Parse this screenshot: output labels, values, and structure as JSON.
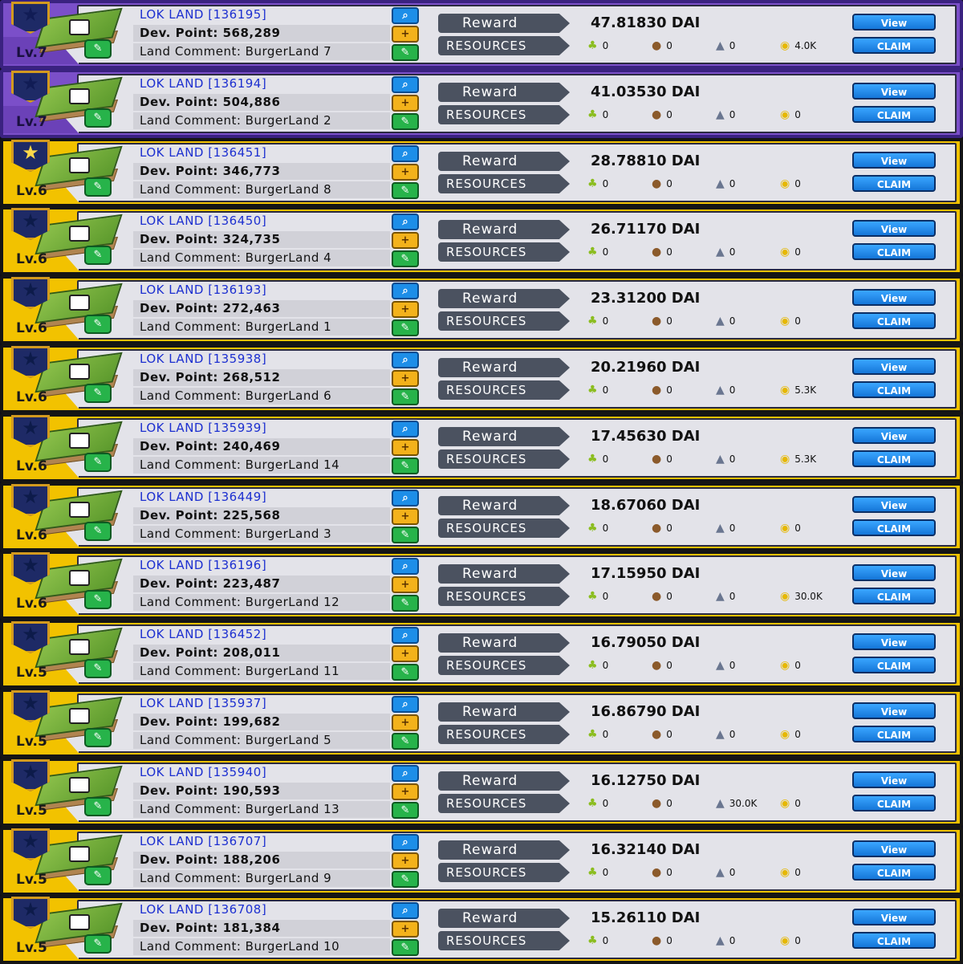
{
  "resource_icons": [
    "corn-icon",
    "meat-icon",
    "stone-icon",
    "gold-icon"
  ],
  "colors": {
    "lv7_frame": "#7b4fc9",
    "gold_frame": "#f2c200",
    "button": "#1576d8",
    "pill": "#4b5260"
  },
  "labels": {
    "reward": "Reward",
    "resources": "RESOURCES",
    "view": "View",
    "claim": "CLAIM"
  },
  "lands": [
    {
      "level": "Lv.7",
      "name": "LOK LAND [136195]",
      "dev": "Dev. Point: 568,289",
      "comment": "Land Comment: BurgerLand 7",
      "reward": "47.81830 DAI",
      "res": [
        "0",
        "0",
        "0",
        "4.0K"
      ],
      "star": "dark",
      "frame": "lv7"
    },
    {
      "level": "Lv.7",
      "name": "LOK LAND [136194]",
      "dev": "Dev. Point: 504,886",
      "comment": "Land Comment: BurgerLand 2",
      "reward": "41.03530 DAI",
      "res": [
        "0",
        "0",
        "0",
        "0"
      ],
      "star": "dark",
      "frame": "lv7"
    },
    {
      "level": "Lv.6",
      "name": "LOK LAND [136451]",
      "dev": "Dev. Point: 346,773",
      "comment": "Land Comment: BurgerLand 8",
      "reward": "28.78810 DAI",
      "res": [
        "0",
        "0",
        "0",
        "0"
      ],
      "star": "yellow",
      "frame": "gold"
    },
    {
      "level": "Lv.6",
      "name": "LOK LAND [136450]",
      "dev": "Dev. Point: 324,735",
      "comment": "Land Comment: BurgerLand 4",
      "reward": "26.71170 DAI",
      "res": [
        "0",
        "0",
        "0",
        "0"
      ],
      "star": "dark",
      "frame": "gold"
    },
    {
      "level": "Lv.6",
      "name": "LOK LAND [136193]",
      "dev": "Dev. Point: 272,463",
      "comment": "Land Comment: BurgerLand 1",
      "reward": "23.31200 DAI",
      "res": [
        "0",
        "0",
        "0",
        "0"
      ],
      "star": "dark",
      "frame": "gold"
    },
    {
      "level": "Lv.6",
      "name": "LOK LAND [135938]",
      "dev": "Dev. Point: 268,512",
      "comment": "Land Comment: BurgerLand 6",
      "reward": "20.21960 DAI",
      "res": [
        "0",
        "0",
        "0",
        "5.3K"
      ],
      "star": "dark",
      "frame": "gold"
    },
    {
      "level": "Lv.6",
      "name": "LOK LAND [135939]",
      "dev": "Dev. Point: 240,469",
      "comment": "Land Comment: BurgerLand 14",
      "reward": "17.45630 DAI",
      "res": [
        "0",
        "0",
        "0",
        "5.3K"
      ],
      "star": "dark",
      "frame": "gold"
    },
    {
      "level": "Lv.6",
      "name": "LOK LAND [136449]",
      "dev": "Dev. Point: 225,568",
      "comment": "Land Comment: BurgerLand 3",
      "reward": "18.67060 DAI",
      "res": [
        "0",
        "0",
        "0",
        "0"
      ],
      "star": "dark",
      "frame": "gold"
    },
    {
      "level": "Lv.6",
      "name": "LOK LAND [136196]",
      "dev": "Dev. Point: 223,487",
      "comment": "Land Comment: BurgerLand 12",
      "reward": "17.15950 DAI",
      "res": [
        "0",
        "0",
        "0",
        "30.0K"
      ],
      "star": "dark",
      "frame": "gold"
    },
    {
      "level": "Lv.5",
      "name": "LOK LAND [136452]",
      "dev": "Dev. Point: 208,011",
      "comment": "Land Comment: BurgerLand 11",
      "reward": "16.79050 DAI",
      "res": [
        "0",
        "0",
        "0",
        "0"
      ],
      "star": "dark",
      "frame": "gold"
    },
    {
      "level": "Lv.5",
      "name": "LOK LAND [135937]",
      "dev": "Dev. Point: 199,682",
      "comment": "Land Comment: BurgerLand 5",
      "reward": "16.86790 DAI",
      "res": [
        "0",
        "0",
        "0",
        "0"
      ],
      "star": "dark",
      "frame": "gold"
    },
    {
      "level": "Lv.5",
      "name": "LOK LAND [135940]",
      "dev": "Dev. Point: 190,593",
      "comment": "Land Comment: BurgerLand 13",
      "reward": "16.12750 DAI",
      "res": [
        "0",
        "0",
        "30.0K",
        "0"
      ],
      "star": "dark",
      "frame": "gold"
    },
    {
      "level": "Lv.5",
      "name": "LOK LAND [136707]",
      "dev": "Dev. Point: 188,206",
      "comment": "Land Comment: BurgerLand 9",
      "reward": "16.32140 DAI",
      "res": [
        "0",
        "0",
        "0",
        "0"
      ],
      "star": "dark",
      "frame": "gold"
    },
    {
      "level": "Lv.5",
      "name": "LOK LAND [136708]",
      "dev": "Dev. Point: 181,384",
      "comment": "Land Comment: BurgerLand 10",
      "reward": "15.26110 DAI",
      "res": [
        "0",
        "0",
        "0",
        "0"
      ],
      "star": "dark",
      "frame": "gold"
    }
  ]
}
